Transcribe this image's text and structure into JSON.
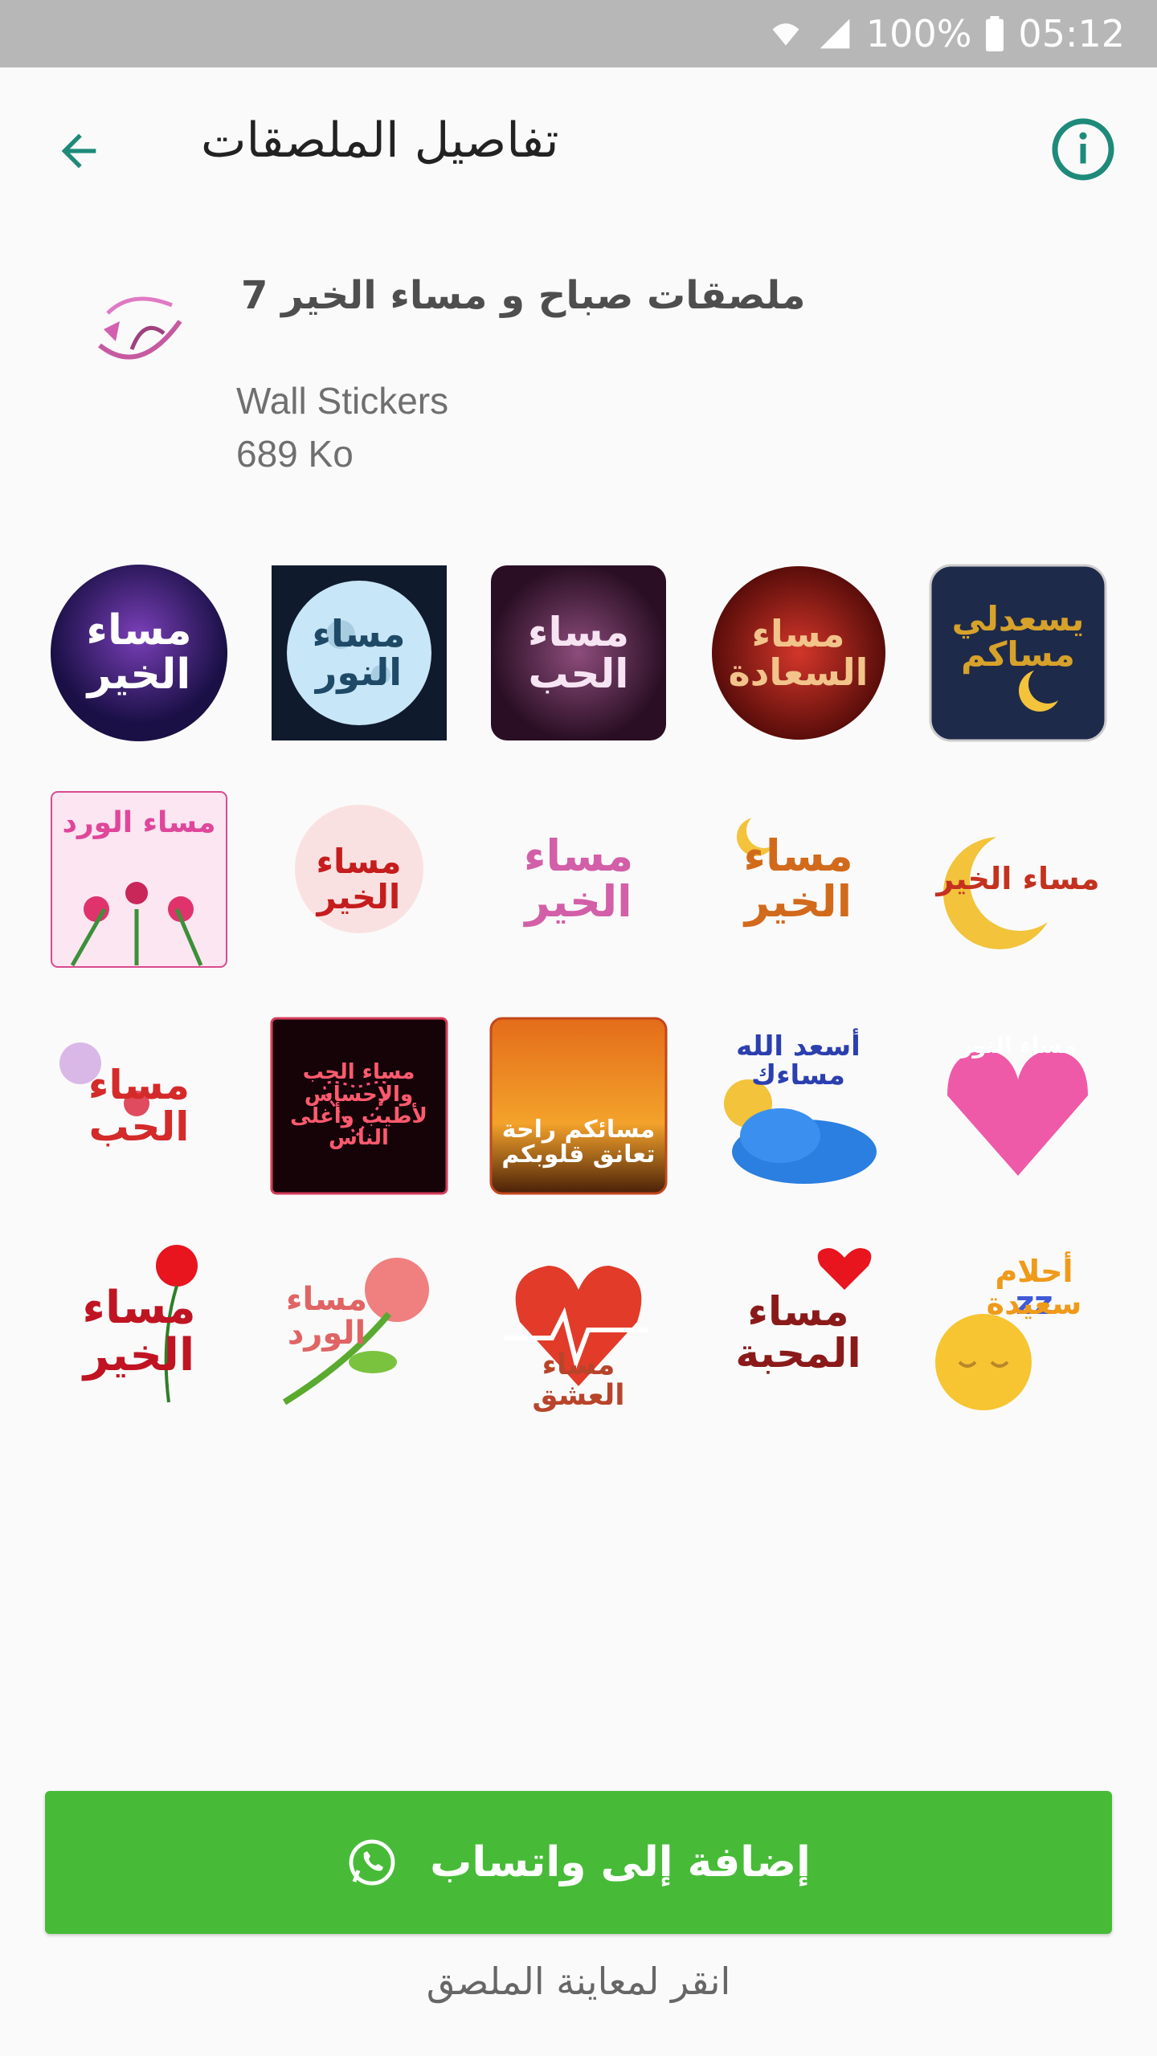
{
  "status_bar": {
    "battery": "100%",
    "time": "05:12"
  },
  "app_bar": {
    "title": "تفاصيل الملصقات"
  },
  "pack": {
    "name": "ملصقات صباح و مساء الخير 7",
    "publisher": "Wall Stickers",
    "size": "689 Ko",
    "tray_text": "الخير\nمساء"
  },
  "stickers": [
    [
      {
        "text": "مساء\nالخير"
      },
      {
        "text": "مساء\nالنور"
      },
      {
        "text": "مساء\nالحب"
      },
      {
        "text": "مساء\nالسعادة"
      },
      {
        "text": "يسعدلي\nمساكم"
      }
    ],
    [
      {
        "text": "مساء الورد"
      },
      {
        "text": "مساء\nالخير"
      },
      {
        "text": "مساء\nالخير"
      },
      {
        "text": "مساء\nالخير"
      },
      {
        "text": "مساء الخير"
      }
    ],
    [
      {
        "text": "مساء\nالحب"
      },
      {
        "text": "مساء الحب\nوالإحساس\nلأطيب وأغلى\nالناس"
      },
      {
        "text": "مسائكم راحة\nتعانق قلوبكم"
      },
      {
        "text": "أسعد الله\nمساءك"
      },
      {
        "text": "مساء النور"
      }
    ],
    [
      {
        "text": "مساء\nالخير"
      },
      {
        "text": "مساء\nالورد"
      },
      {
        "text": "مساء\nالعشق"
      },
      {
        "text": "مساء\nالمحبة"
      },
      {
        "text": "أحلام\nسعيدة"
      }
    ]
  ],
  "add_button": {
    "label": "إضافة إلى واتساب"
  },
  "preview_hint": "انقر لمعاينة الملصق",
  "colors": {
    "status_bar": "#b7b7b7",
    "accent": "#1e8a7a",
    "add_button": "#47bb37"
  }
}
